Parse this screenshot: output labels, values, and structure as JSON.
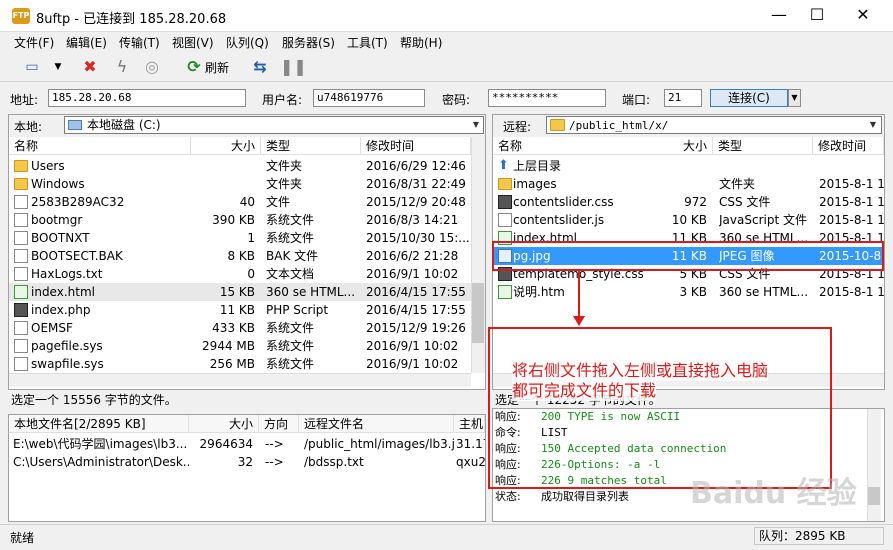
{
  "window": {
    "title": "8uftp - 已连接到 185.28.20.68",
    "minimize": "—",
    "maximize": "☐",
    "close": "✕"
  },
  "menu": [
    "文件(F)",
    "编辑(E)",
    "传输(T)",
    "视图(V)",
    "队列(Q)",
    "服务器(S)",
    "工具(T)",
    "帮助(H)"
  ],
  "toolbar": {
    "refresh_label": "刷新"
  },
  "address": {
    "host_label": "地址:",
    "host_value": "185.28.20.68",
    "user_label": "用户名:",
    "user_value": "u748619776",
    "pass_label": "密码:",
    "pass_value": "**********",
    "port_label": "端口:",
    "port_value": "21",
    "connect_label": "连接(C)"
  },
  "local": {
    "path_label": "本地:",
    "path_value": "本地磁盘 (C:)",
    "columns": [
      "名称",
      "大小",
      "类型",
      "修改时间"
    ],
    "rows": [
      {
        "name": "Users",
        "size": "",
        "type": "文件夹",
        "date": "2016/6/29 12:46",
        "icon": "folder"
      },
      {
        "name": "Windows",
        "size": "",
        "type": "文件夹",
        "date": "2016/8/31 22:49",
        "icon": "folder"
      },
      {
        "name": "2583B289AC32",
        "size": "40",
        "type": "文件",
        "date": "2015/12/9 20:48",
        "icon": "doc"
      },
      {
        "name": "bootmgr",
        "size": "390 KB",
        "type": "系统文件",
        "date": "2016/8/3 14:21",
        "icon": "doc"
      },
      {
        "name": "BOOTNXT",
        "size": "1",
        "type": "系统文件",
        "date": "2015/10/30 15:...",
        "icon": "doc"
      },
      {
        "name": "BOOTSECT.BAK",
        "size": "8 KB",
        "type": "BAK 文件",
        "date": "2016/6/2 21:28",
        "icon": "doc"
      },
      {
        "name": "HaxLogs.txt",
        "size": "0",
        "type": "文本文档",
        "date": "2016/9/1 10:02",
        "icon": "doc"
      },
      {
        "name": "index.html",
        "size": "15 KB",
        "type": "360 se HTML...",
        "date": "2016/4/15 17:55",
        "icon": "doc-g"
      },
      {
        "name": "index.php",
        "size": "11 KB",
        "type": "PHP Script",
        "date": "2016/4/15 17:55",
        "icon": "doc-k"
      },
      {
        "name": "OEMSF",
        "size": "433 KB",
        "type": "系统文件",
        "date": "2015/12/9 19:26",
        "icon": "doc"
      },
      {
        "name": "pagefile.sys",
        "size": "2944 MB",
        "type": "系统文件",
        "date": "2016/9/1 10:02",
        "icon": "doc"
      },
      {
        "name": "swapfile.sys",
        "size": "256 MB",
        "type": "系统文件",
        "date": "2016/9/1 10:02",
        "icon": "doc"
      }
    ],
    "status": "选定一个 15556 字节的文件。"
  },
  "remote": {
    "path_label": "远程:",
    "path_value": "/public_html/x/",
    "columns": [
      "名称",
      "大小",
      "类型",
      "修改时间"
    ],
    "rows": [
      {
        "name": "上层目录",
        "size": "",
        "type": "",
        "date": "",
        "icon": "up"
      },
      {
        "name": "images",
        "size": "",
        "type": "文件夹",
        "date": "2015-8-1 1",
        "icon": "folder"
      },
      {
        "name": "contentslider.css",
        "size": "972",
        "type": "CSS 文件",
        "date": "2015-8-1 1",
        "icon": "doc-k"
      },
      {
        "name": "contentslider.js",
        "size": "10 KB",
        "type": "JavaScript 文件",
        "date": "2015-8-1 1",
        "icon": "doc"
      },
      {
        "name": "index.html",
        "size": "11 KB",
        "type": "360 se HTML...",
        "date": "2015-8-1 1",
        "icon": "doc-g"
      },
      {
        "name": "pg.jpg",
        "size": "11 KB",
        "type": "JPEG 图像",
        "date": "2015-10-8",
        "icon": "doc-b"
      },
      {
        "name": "templatemo_style.css",
        "size": "5 KB",
        "type": "CSS 文件",
        "date": "2015-8-1 1",
        "icon": "doc-k"
      },
      {
        "name": "说明.htm",
        "size": "3 KB",
        "type": "360 se HTML...",
        "date": "2015-8-1 1",
        "icon": "doc-g"
      }
    ],
    "status": "选定一个 12252 字节的文件。"
  },
  "queue": {
    "columns": [
      "本地文件名[2/2895 KB]",
      "大小",
      "方向",
      "远程文件名",
      "主机"
    ],
    "rows": [
      {
        "local": "E:\\web\\代码学园\\images\\lb3...",
        "size": "2964634",
        "dir": "-->",
        "remote": "/public_html/images/lb3.j...",
        "host": "31.170"
      },
      {
        "local": "C:\\Users\\Administrator\\Desk...",
        "size": "32",
        "dir": "-->",
        "remote": "/bdssp.txt",
        "host": "qxu23"
      }
    ]
  },
  "log": [
    {
      "label": "响应:",
      "text": "200 TYPE is now ASCII",
      "color": "#1a8a1a"
    },
    {
      "label": "命令:",
      "text": "LIST",
      "color": "#000000"
    },
    {
      "label": "响应:",
      "text": "150 Accepted data connection",
      "color": "#1a8a1a"
    },
    {
      "label": "响应:",
      "text": "226-Options: -a -l",
      "color": "#1a8a1a"
    },
    {
      "label": "响应:",
      "text": "226 9 matches total",
      "color": "#1a8a1a"
    },
    {
      "label": "状态:",
      "text": "成功取得目录列表",
      "color": "#000000"
    }
  ],
  "annotation": {
    "line1": "将右侧文件拖入左侧或直接拖入电脑",
    "line2": "都可完成文件的下载"
  },
  "statusbar": {
    "left": "就绪",
    "right": "队列：2895 KB"
  },
  "watermark": "Baidu 经验"
}
